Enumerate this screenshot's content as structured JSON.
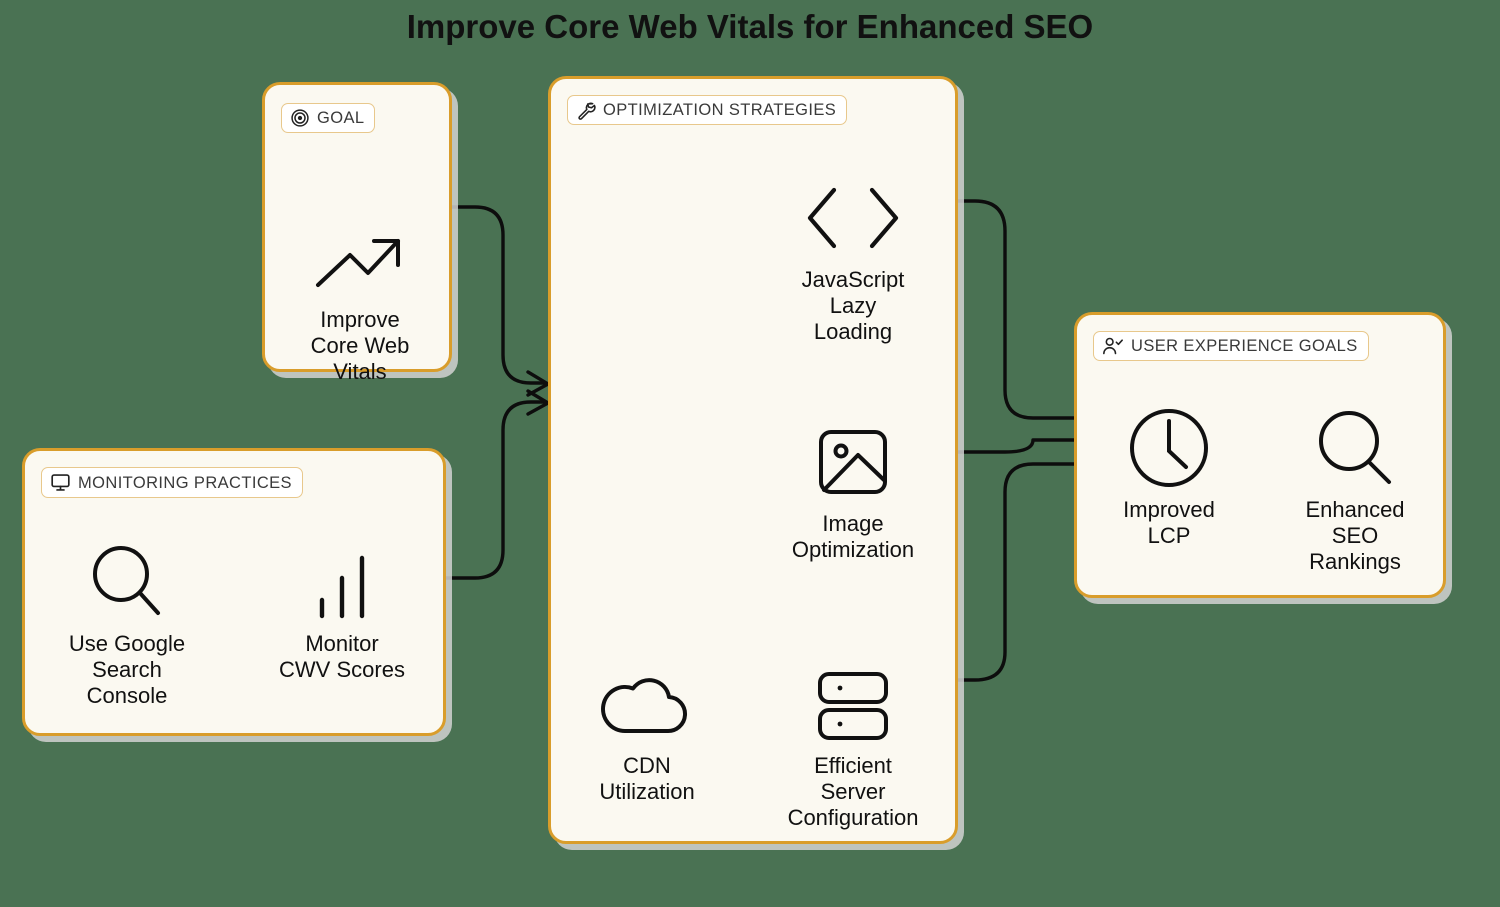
{
  "page": {
    "title": "Improve Core Web Vitals for Enhanced SEO",
    "background_color": "#4a7253",
    "card_background": "#fbf9f1",
    "card_border": "#d99d2b",
    "chip_background": "#ffffff",
    "chip_border": "#e8c88c",
    "line_color": "#0d0d0d",
    "text_color": "#111111"
  },
  "cards": {
    "goal": {
      "chip_label": "GOAL",
      "chip_icon": "target-icon",
      "nodes": [
        {
          "id": "improve-core-web-vitals",
          "icon": "trending-up-icon",
          "label": "Improve\nCore Web\nVitals"
        }
      ]
    },
    "monitoring": {
      "chip_label": "MONITORING PRACTICES",
      "chip_icon": "monitor-icon",
      "nodes": [
        {
          "id": "use-google-search-console",
          "icon": "search-icon",
          "label": "Use Google\nSearch\nConsole"
        },
        {
          "id": "monitor-cwv-scores",
          "icon": "bar-chart-icon",
          "label": "Monitor\nCWV Scores"
        }
      ]
    },
    "optimization": {
      "chip_label": "OPTIMIZATION STRATEGIES",
      "chip_icon": "wrench-icon",
      "nodes": [
        {
          "id": "javascript-lazy-loading",
          "icon": "code-brackets-icon",
          "label": "JavaScript\nLazy\nLoading"
        },
        {
          "id": "image-optimization",
          "icon": "image-icon",
          "label": "Image\nOptimization"
        },
        {
          "id": "cdn-utilization",
          "icon": "cloud-icon",
          "label": "CDN\nUtilization"
        },
        {
          "id": "efficient-server-configuration",
          "icon": "server-icon",
          "label": "Efficient\nServer\nConfiguration"
        }
      ]
    },
    "user_experience": {
      "chip_label": "USER EXPERIENCE GOALS",
      "chip_icon": "user-check-icon",
      "nodes": [
        {
          "id": "improved-lcp",
          "icon": "clock-icon",
          "label": "Improved\nLCP"
        },
        {
          "id": "enhanced-seo-rankings",
          "icon": "magnifier-icon",
          "label": "Enhanced\nSEO\nRankings"
        }
      ]
    }
  },
  "connections": [
    {
      "from": "improve-core-web-vitals",
      "to": "optimization-card"
    },
    {
      "from": "monitor-cwv-scores",
      "to": "optimization-card"
    },
    {
      "from": "use-google-search-console",
      "to": "monitor-cwv-scores"
    },
    {
      "from": "cdn-utilization",
      "to": "efficient-server-configuration"
    },
    {
      "from": "javascript-lazy-loading",
      "to": "improved-lcp"
    },
    {
      "from": "image-optimization",
      "to": "improved-lcp"
    },
    {
      "from": "efficient-server-configuration",
      "to": "improved-lcp"
    },
    {
      "from": "improved-lcp",
      "to": "enhanced-seo-rankings"
    }
  ]
}
